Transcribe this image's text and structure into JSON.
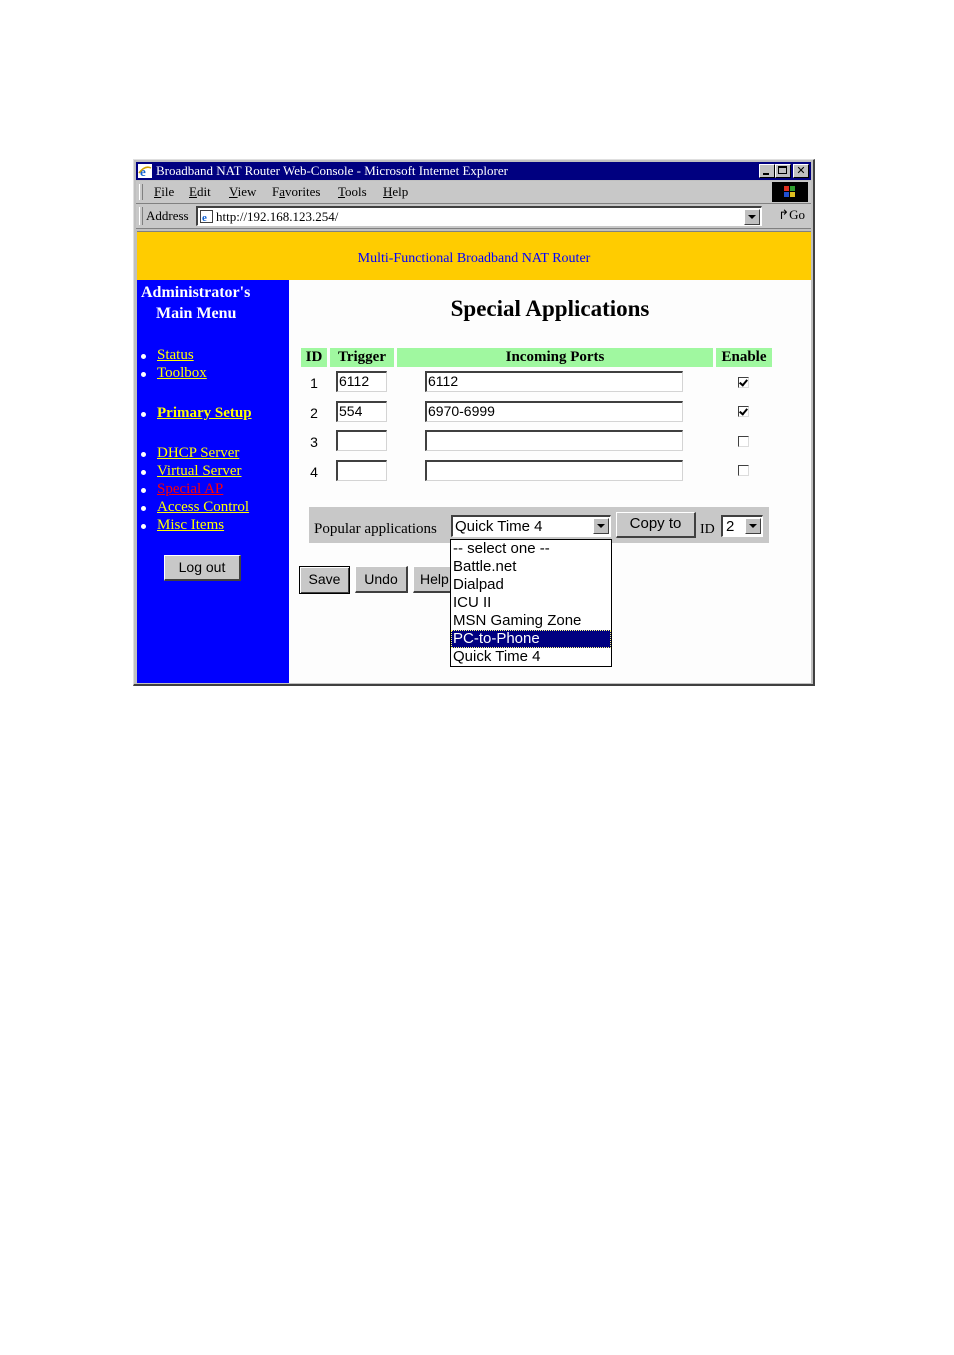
{
  "window": {
    "title": "Broadband NAT Router Web-Console - Microsoft Internet Explorer",
    "controls": {
      "minimize": "_",
      "maximize": "□",
      "close": "×"
    }
  },
  "menubar": {
    "items": [
      {
        "label": "File",
        "accel": "F"
      },
      {
        "label": "Edit",
        "accel": "E"
      },
      {
        "label": "View",
        "accel": "V"
      },
      {
        "label": "Favorites",
        "accel": "a"
      },
      {
        "label": "Tools",
        "accel": "T"
      },
      {
        "label": "Help",
        "accel": "H"
      }
    ]
  },
  "addressbar": {
    "label": "Address",
    "url": "http://192.168.123.254/",
    "go_label": "Go"
  },
  "banner": {
    "text": "Multi-Functional Broadband NAT Router",
    "color": "#ffcc00"
  },
  "sidebar": {
    "title_line1": "Administrator's",
    "title_line2": "Main Menu",
    "bg_color": "#0000ff",
    "link_color": "#ffff00",
    "active_color": "#ff0000",
    "items": [
      {
        "label": "Status"
      },
      {
        "label": "Toolbox"
      },
      {
        "label": "Primary Setup"
      },
      {
        "label": "DHCP Server"
      },
      {
        "label": "Virtual Server"
      },
      {
        "label": "Special AP"
      },
      {
        "label": "Access Control"
      },
      {
        "label": "Misc Items"
      }
    ],
    "active_item": "Special AP",
    "logout_label": "Log out"
  },
  "main": {
    "title": "Special Applications",
    "table": {
      "headers": [
        "ID",
        "Trigger",
        "Incoming Ports",
        "Enable"
      ],
      "header_color": "#a0f8a0",
      "rows": [
        {
          "id": "1",
          "trigger": "6112",
          "incoming": "6112",
          "enabled": true
        },
        {
          "id": "2",
          "trigger": "554",
          "incoming": "6970-6999",
          "enabled": true
        },
        {
          "id": "3",
          "trigger": "",
          "incoming": "",
          "enabled": false
        },
        {
          "id": "4",
          "trigger": "",
          "incoming": "",
          "enabled": false
        }
      ]
    },
    "popular": {
      "label": "Popular applications",
      "selected": "Quick Time 4",
      "options": [
        "-- select one --",
        "Battle.net",
        "Dialpad",
        "ICU II",
        "MSN Gaming Zone",
        "PC-to-Phone",
        "Quick Time 4"
      ],
      "highlighted": "PC-to-Phone",
      "copy_label": "Copy to",
      "id_label": "ID",
      "id_value": "2"
    },
    "buttons": {
      "save": "Save",
      "undo": "Undo",
      "help": "Help"
    }
  }
}
